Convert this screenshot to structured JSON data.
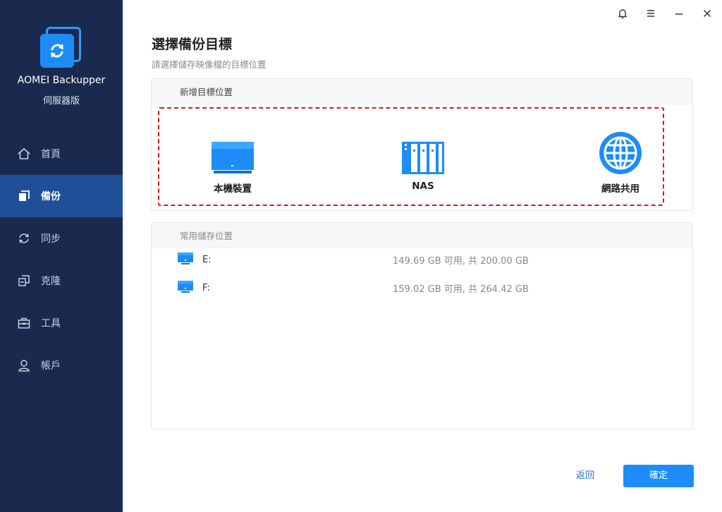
{
  "app": {
    "name": "AOMEI Backupper",
    "edition": "伺服器版"
  },
  "sidebar": {
    "items": [
      {
        "label": "首頁",
        "icon": "home-icon",
        "active": false
      },
      {
        "label": "備份",
        "icon": "backup-icon",
        "active": true
      },
      {
        "label": "同步",
        "icon": "sync-icon",
        "active": false
      },
      {
        "label": "克隆",
        "icon": "clone-icon",
        "active": false
      },
      {
        "label": "工具",
        "icon": "toolbox-icon",
        "active": false
      },
      {
        "label": "帳戶",
        "icon": "user-icon",
        "active": false
      }
    ]
  },
  "window": {
    "controls": [
      "bell-icon",
      "menu-icon",
      "minimize-icon",
      "close-icon"
    ]
  },
  "page": {
    "title": "選擇備份目標",
    "subtitle": "請選擇儲存映像檔的目標位置"
  },
  "add_target": {
    "header": "新增目標位置",
    "options": [
      {
        "label": "本機裝置",
        "icon": "monitor-icon"
      },
      {
        "label": "NAS",
        "icon": "nas-icon"
      },
      {
        "label": "網路共用",
        "icon": "globe-icon"
      }
    ]
  },
  "common_storage": {
    "header": "常用儲存位置",
    "drives": [
      {
        "name": "E:",
        "space": "149.69 GB 可用, 共 200.00 GB"
      },
      {
        "name": "F:",
        "space": "159.02 GB 可用, 共 264.42 GB"
      }
    ]
  },
  "footer": {
    "back_label": "返回",
    "ok_label": "確定"
  },
  "colors": {
    "sidebar_bg": "#1a2a4f",
    "sidebar_active": "#1f4f98",
    "accent": "#1d8cf8",
    "highlight_border": "#e0141e"
  }
}
